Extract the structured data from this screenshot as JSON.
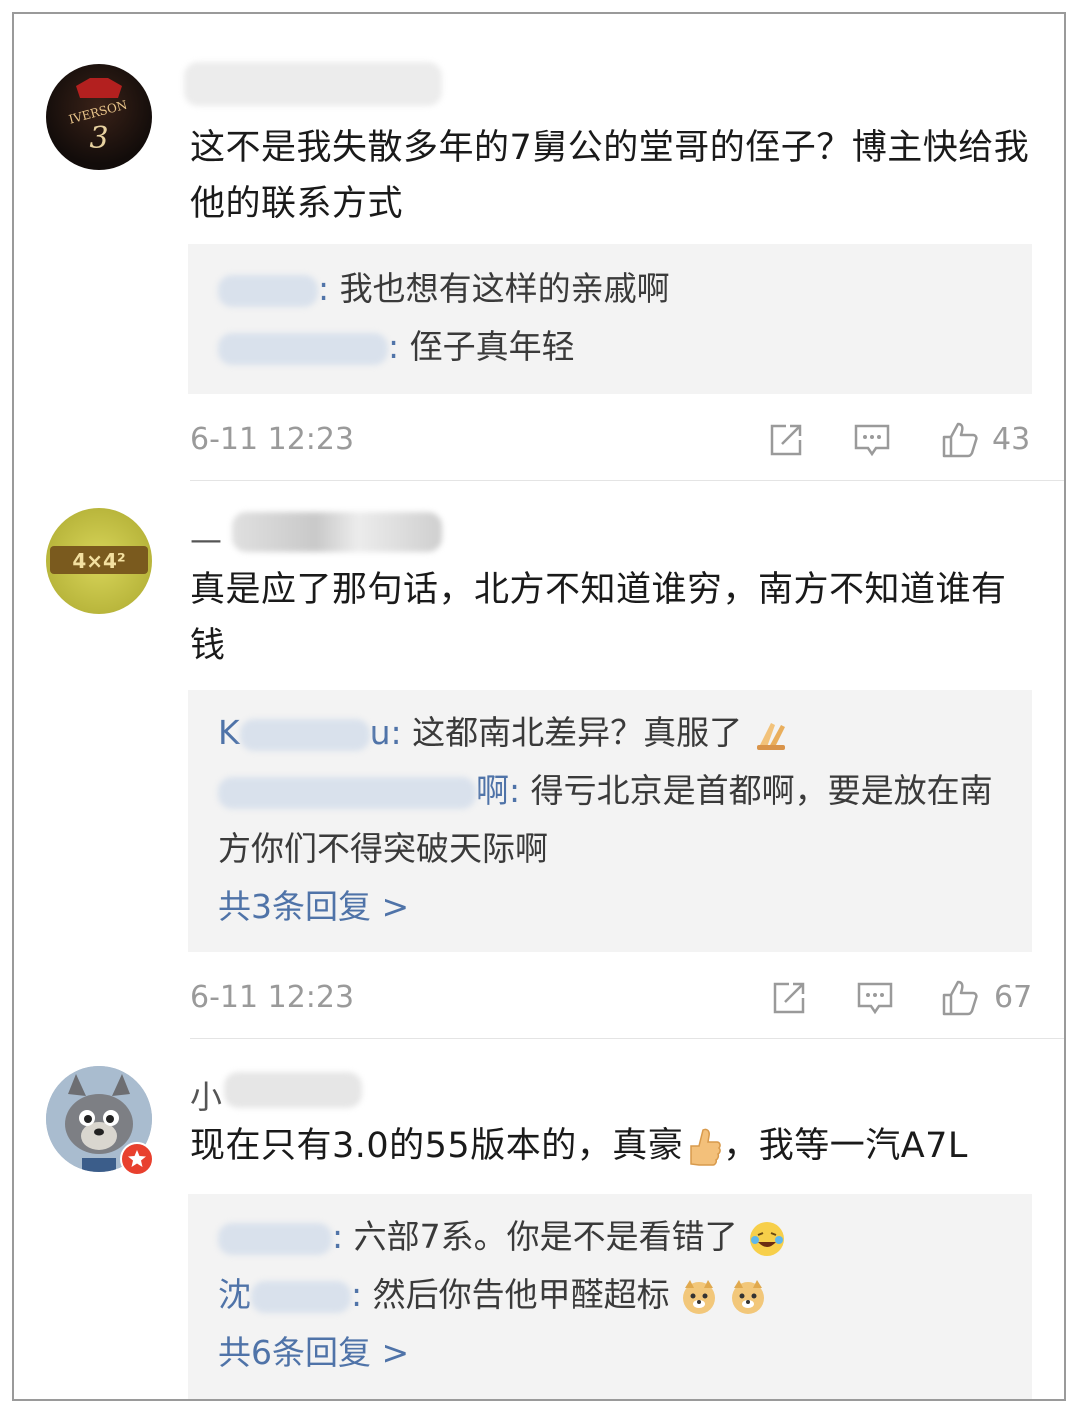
{
  "comments": [
    {
      "avatar_icon": "iverson-jersey-avatar",
      "avatar_text": "IVERSON",
      "avatar_number": "3",
      "text": "这不是我失散多年的7舅公的堂哥的侄子？博主快给我他的联系方式",
      "replies": [
        {
          "name_suffix": ":",
          "text": " 我也想有这样的亲戚啊"
        },
        {
          "name_suffix": ":",
          "text": " 侄子真年轻"
        }
      ],
      "time": "6-11 12:23",
      "likes": "43"
    },
    {
      "avatar_icon": "4x4-sign-avatar",
      "avatar_text": "4×4²",
      "name_visible": "—",
      "text": "真是应了那句话，北方不知道谁穷，南方不知道谁有钱",
      "replies": [
        {
          "name_prefix": "K",
          "name_suffix": "u:",
          "text": " 这都南北差异？真服了"
        },
        {
          "name_suffix": "啊:",
          "text": " 得亏北京是首都啊，要是放在南方你们不得突破天际啊"
        }
      ],
      "more": "共3条回复 >",
      "time": "6-11 12:23",
      "likes": "67"
    },
    {
      "avatar_icon": "grey-wolf-avatar",
      "name_visible": "小",
      "text_a": "现在只有3.0的55版本的，真豪",
      "text_b": "，我等一汽A7L",
      "replies": [
        {
          "name_suffix": ":",
          "text": " 六部7系。你是不是看错了"
        },
        {
          "name_prefix": "沈",
          "name_suffix": ":",
          "text": " 然后你告他甲醛超标"
        }
      ],
      "more": "共6条回复 >"
    }
  ],
  "colors": {
    "link": "#4f73a8",
    "meta": "#9a9a9a",
    "reply_bg": "#f3f3f3"
  }
}
